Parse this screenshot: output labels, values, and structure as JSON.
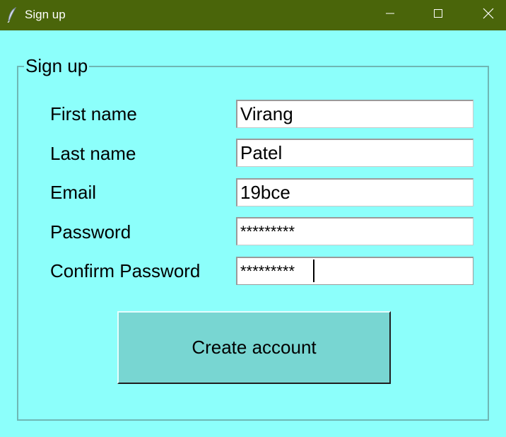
{
  "window": {
    "title": "Sign up",
    "icon": "feather-icon",
    "controls": [
      "minimize-icon",
      "maximize-icon",
      "close-icon"
    ]
  },
  "form": {
    "group_title": "Sign up",
    "fields": [
      {
        "label": "First name",
        "value": "Virang"
      },
      {
        "label": "Last name",
        "value": "Patel"
      },
      {
        "label": "Email",
        "value": "19bce"
      },
      {
        "label": "Password",
        "value": "*********"
      },
      {
        "label": "Confirm Password",
        "value": "*********"
      }
    ],
    "submit_label": "Create account"
  },
  "colors": {
    "titlebar": "#4a650a",
    "background": "#8cfffb",
    "button": "#78d6d2"
  }
}
